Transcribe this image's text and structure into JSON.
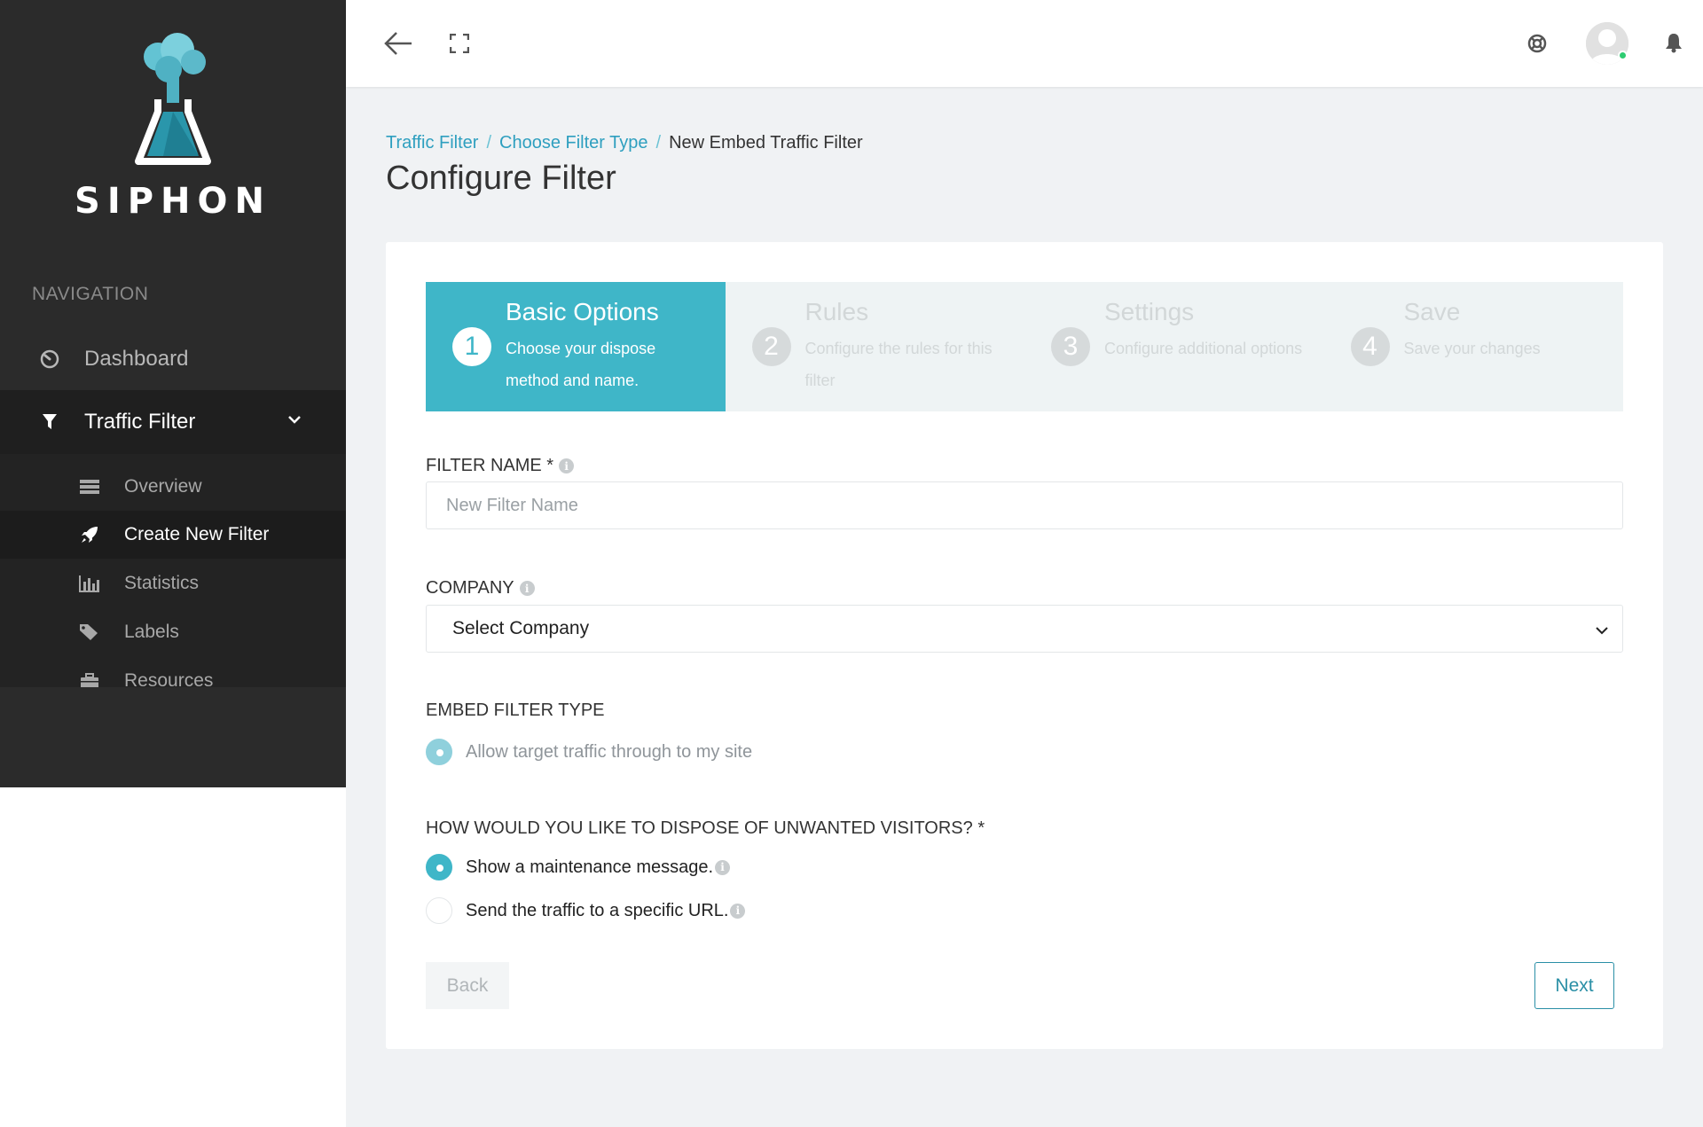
{
  "brand": {
    "name": "SIPHON"
  },
  "colors": {
    "accent": "#3fb6c8",
    "sidebar_bg": "#2b2b2b",
    "link": "#2e9fbf",
    "online": "#2ecc71"
  },
  "sidebar": {
    "heading": "NAVIGATION",
    "dashboard": {
      "label": "Dashboard",
      "icon": "dashboard-gauge-icon"
    },
    "traffic_filter": {
      "label": "Traffic Filter",
      "icon": "filter-funnel-icon",
      "expanded": true
    },
    "sub_items": [
      {
        "label": "Overview",
        "icon": "list-icon"
      },
      {
        "label": "Create New Filter",
        "icon": "rocket-icon",
        "active": true
      },
      {
        "label": "Statistics",
        "icon": "bar-chart-icon"
      },
      {
        "label": "Labels",
        "icon": "tags-icon"
      },
      {
        "label": "Resources",
        "icon": "briefcase-icon"
      }
    ]
  },
  "topbar": {
    "back_icon": "arrow-left-icon",
    "fullscreen_icon": "expand-icon",
    "help_icon": "lifebuoy-icon",
    "notification_icon": "bell-icon"
  },
  "breadcrumb": {
    "items": [
      "Traffic Filter",
      "Choose Filter Type",
      "New Embed Traffic Filter"
    ],
    "separator": "/"
  },
  "page_title": "Configure Filter",
  "wizard": {
    "steps": [
      {
        "number": "1",
        "title": "Basic Options",
        "description": "Choose your dispose method and name.",
        "active": true
      },
      {
        "number": "2",
        "title": "Rules",
        "description": "Configure the rules for this filter",
        "active": false
      },
      {
        "number": "3",
        "title": "Settings",
        "description": "Configure additional options",
        "active": false
      },
      {
        "number": "4",
        "title": "Save",
        "description": "Save your changes",
        "active": false
      }
    ]
  },
  "form": {
    "filter_name": {
      "label": "FILTER NAME *",
      "placeholder": "New Filter Name",
      "value": ""
    },
    "company": {
      "label": "COMPANY",
      "selected": "Select Company"
    },
    "embed_type": {
      "label": "EMBED FILTER TYPE",
      "option": "Allow target traffic through to my site"
    },
    "dispose": {
      "label": "HOW WOULD YOU LIKE TO DISPOSE OF UNWANTED VISITORS? *",
      "options": [
        {
          "label": "Show a maintenance message.",
          "selected": true
        },
        {
          "label": "Send the traffic to a specific URL.",
          "selected": false
        }
      ]
    },
    "buttons": {
      "back": "Back",
      "next": "Next"
    }
  }
}
